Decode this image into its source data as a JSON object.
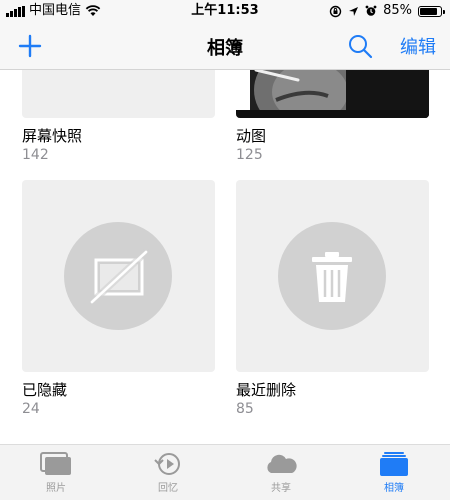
{
  "status_bar": {
    "carrier": "中国电信",
    "time": "上午11:53",
    "battery_percent": "85%",
    "battery_level": 0.85
  },
  "nav": {
    "title": "相簿",
    "edit_label": "编辑"
  },
  "albums": [
    {
      "name": "屏幕快照",
      "count": "142",
      "icon": "blank-thumb"
    },
    {
      "name": "动图",
      "count": "125",
      "icon": "photo-thumb"
    },
    {
      "name": "已隐藏",
      "count": "24",
      "icon": "hidden-photo-icon"
    },
    {
      "name": "最近删除",
      "count": "85",
      "icon": "trash-icon"
    }
  ],
  "tabs": [
    {
      "label": "照片",
      "icon": "photos-icon",
      "active": false
    },
    {
      "label": "回忆",
      "icon": "memories-icon",
      "active": false
    },
    {
      "label": "共享",
      "icon": "cloud-icon",
      "active": false
    },
    {
      "label": "相簿",
      "icon": "albums-icon",
      "active": true
    }
  ],
  "colors": {
    "accent": "#1f7cf6",
    "thumb_bg": "#efefef",
    "icon_circle": "#d1d1d1",
    "secondary_text": "#8e8e93"
  }
}
